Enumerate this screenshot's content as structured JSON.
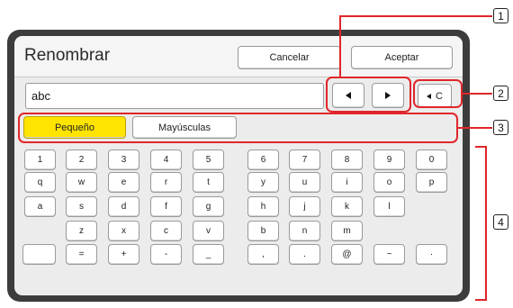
{
  "dialog": {
    "title": "Renombrar",
    "cancel_label": "Cancelar",
    "accept_label": "Aceptar",
    "input_value": "abc",
    "backspace_label": "C"
  },
  "modes": {
    "lowercase": "Pequeño",
    "uppercase": "Mayúsculas"
  },
  "keyboard": {
    "row1_left": [
      "1",
      "2",
      "3",
      "4",
      "5"
    ],
    "row1_right": [
      "6",
      "7",
      "8",
      "9",
      "0"
    ],
    "row2_left": [
      "q",
      "w",
      "e",
      "r",
      "t"
    ],
    "row2_right": [
      "y",
      "u",
      "i",
      "o",
      "p"
    ],
    "row3_left": [
      "a",
      "s",
      "d",
      "f",
      "g"
    ],
    "row3_right": [
      "h",
      "j",
      "k",
      "l"
    ],
    "row4_left": [
      "z",
      "x",
      "c",
      "v"
    ],
    "row4_right": [
      "b",
      "n",
      "m"
    ],
    "row5_left": [
      "",
      "=",
      "+",
      "-",
      "_"
    ],
    "row5_right": [
      ",",
      ".",
      "@",
      "~",
      "·"
    ]
  },
  "callouts": {
    "c1": "1",
    "c2": "2",
    "c3": "3",
    "c4": "4"
  },
  "colors": {
    "accent_yellow": "#ffe400",
    "callout_red": "#e0262b"
  }
}
